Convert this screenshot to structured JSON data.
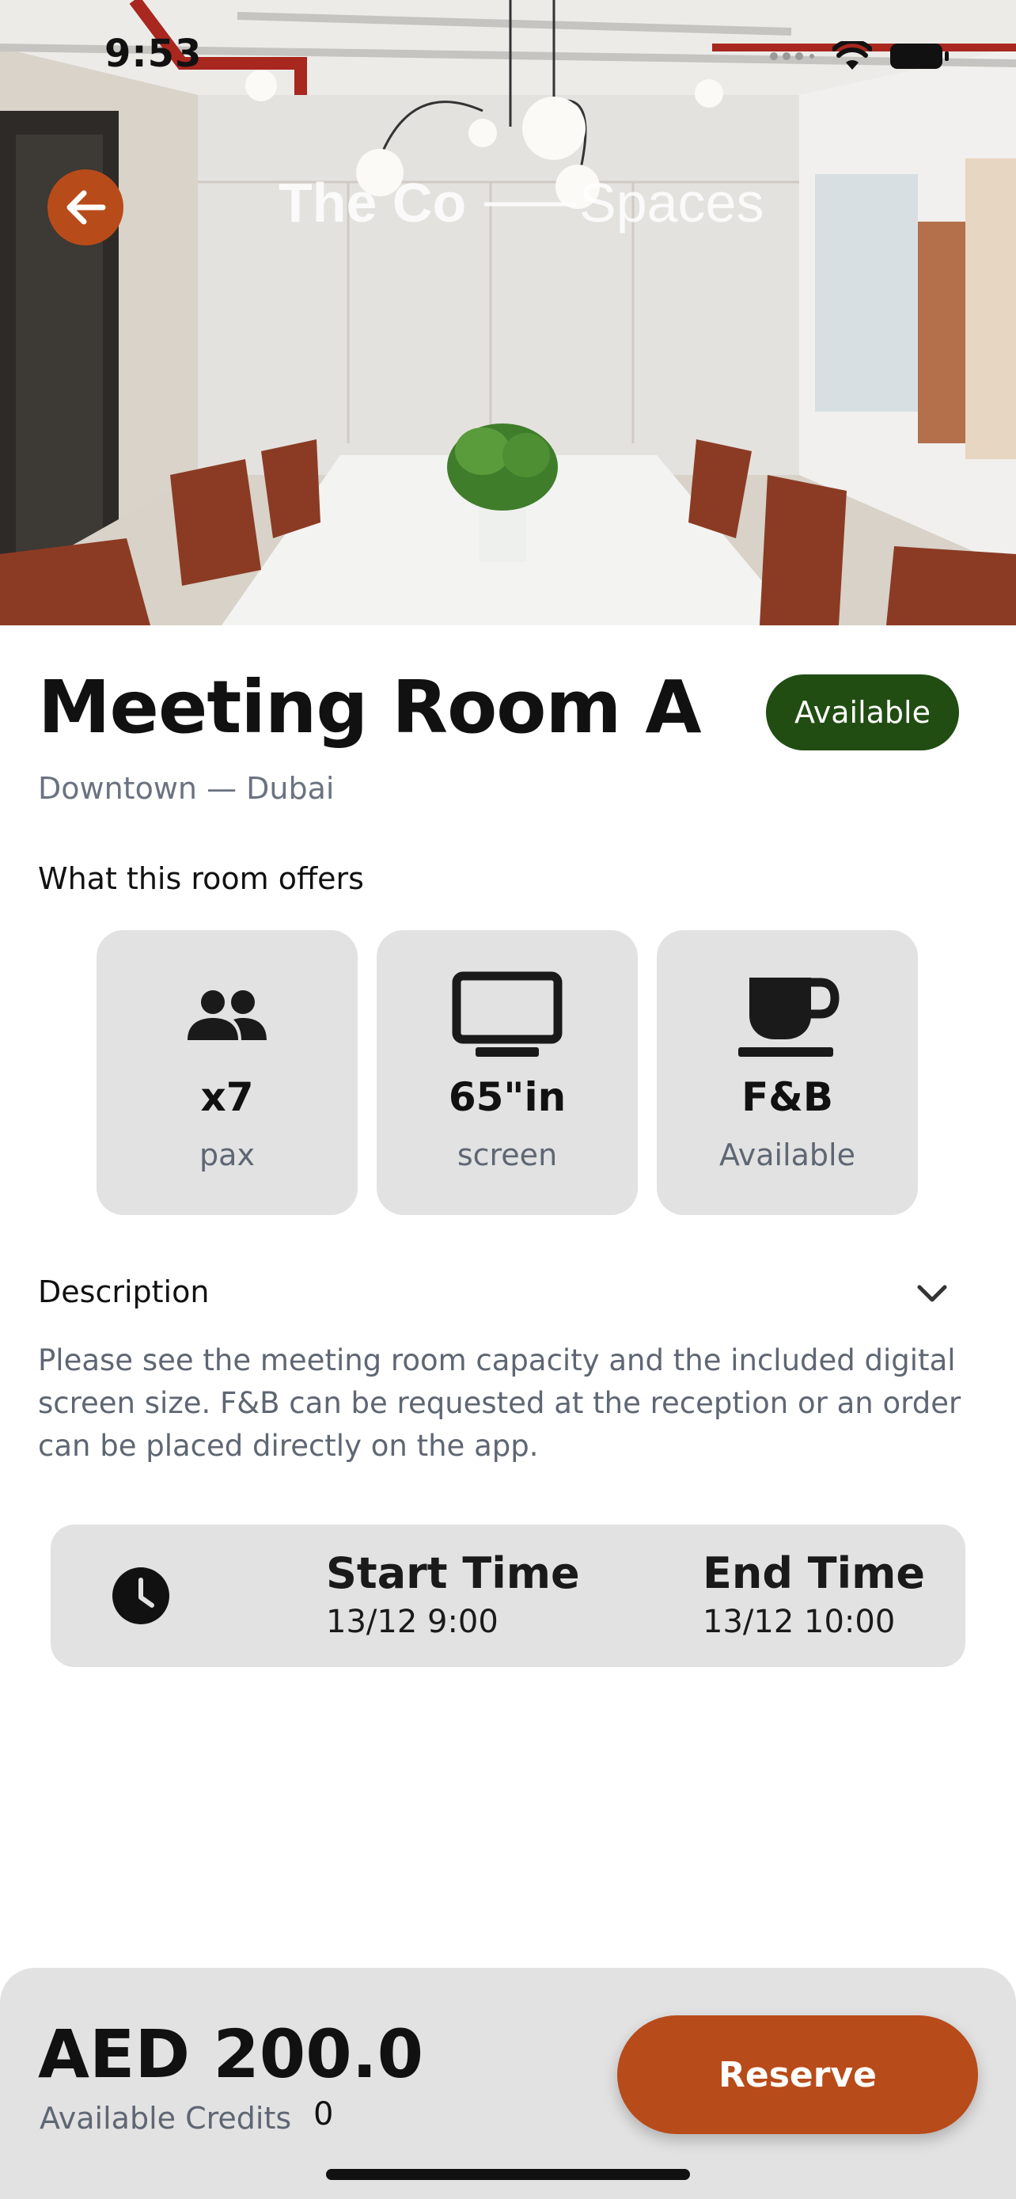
{
  "status_bar": {
    "time": "9:53"
  },
  "hero": {
    "brand_text": "The Co—Spaces",
    "back_icon": "arrow-left-icon"
  },
  "room": {
    "title": "Meeting Room A",
    "location": "Downtown — Dubai",
    "status": "Available"
  },
  "offers": {
    "heading": "What this room offers",
    "items": [
      {
        "icon": "people-icon",
        "value": "x7",
        "label": "pax"
      },
      {
        "icon": "monitor-icon",
        "value": "65\"in",
        "label": "screen"
      },
      {
        "icon": "coffee-cup-icon",
        "value": "F&B",
        "label": "Available"
      }
    ]
  },
  "description": {
    "heading": "Description",
    "body": "Please see the meeting room capacity and the included digital screen size. F&B can be requested at the reception or an order can be placed directly on the app."
  },
  "booking_time": {
    "start_label": "Start Time",
    "start_value": "13/12 9:00",
    "end_label": "End Time",
    "end_value": "13/12 10:00"
  },
  "footer": {
    "price": "AED 200.0",
    "credits_label": "Available Credits",
    "credits_value": "0",
    "reserve_label": "Reserve"
  },
  "colors": {
    "accent": "#b84b1a",
    "badge": "#214d12",
    "card_bg": "#e2e2e2"
  }
}
